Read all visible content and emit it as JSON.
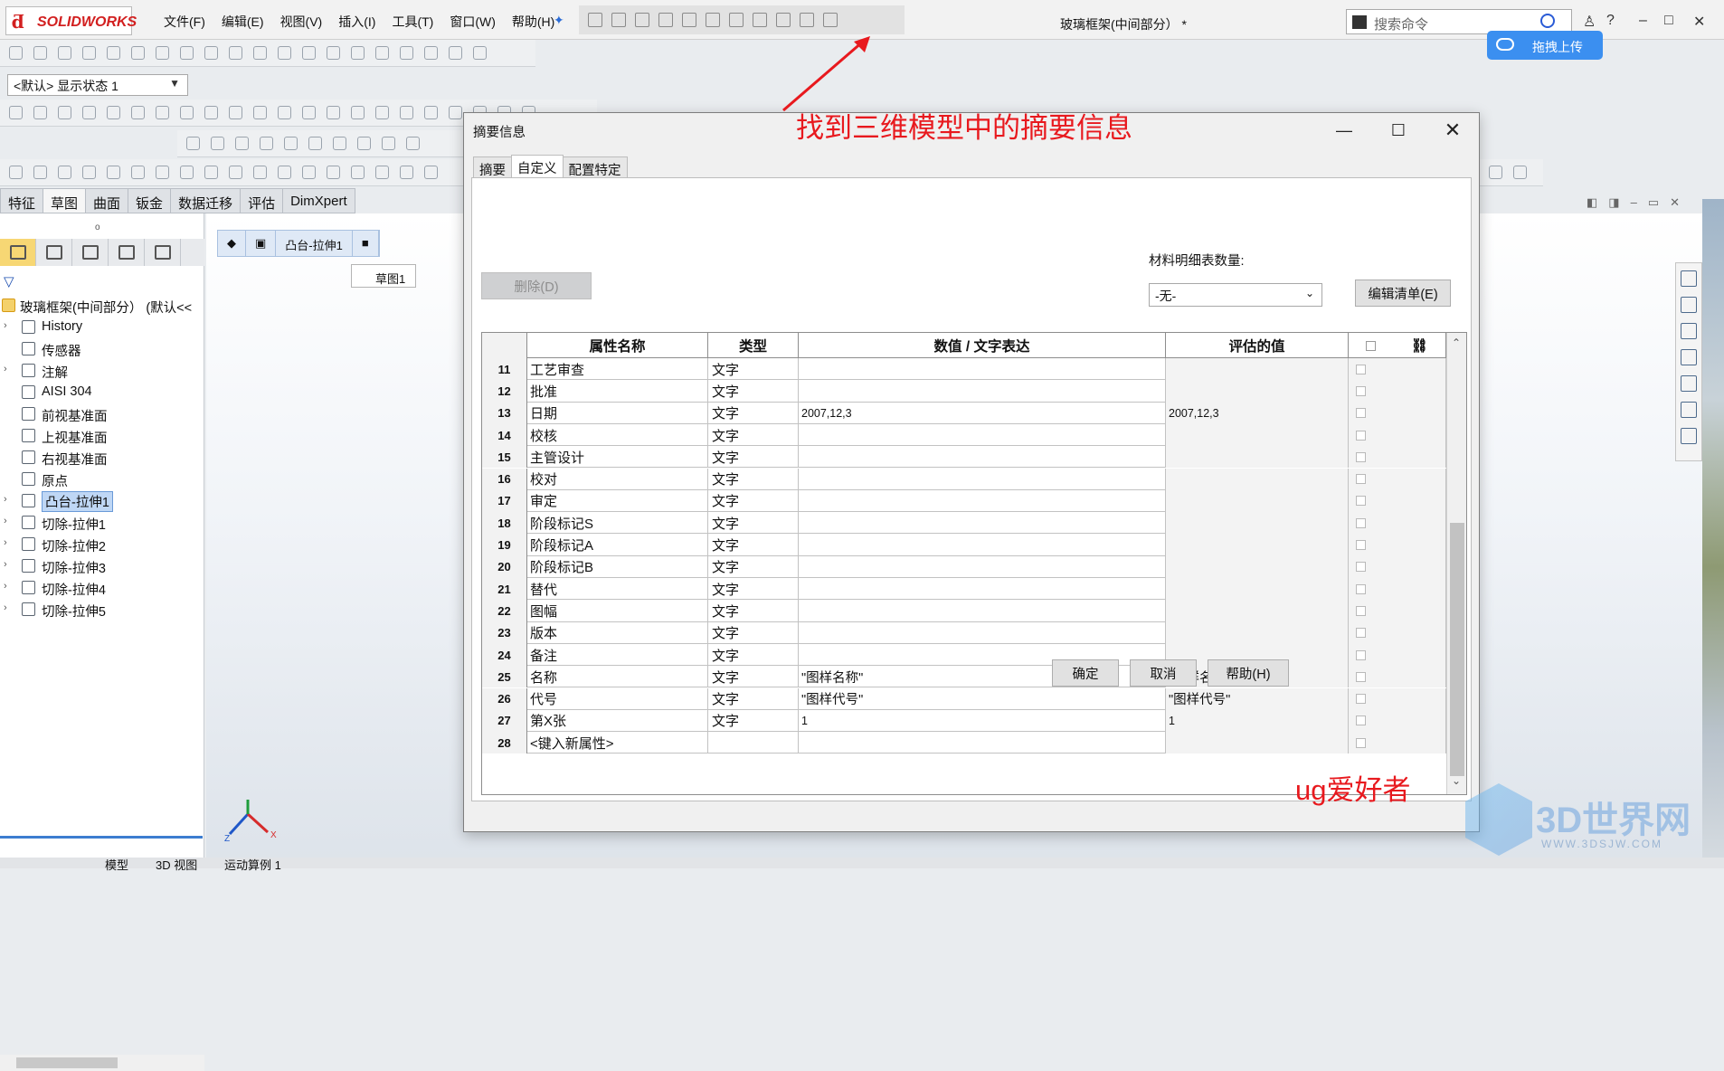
{
  "app": {
    "logo_text": "SOLIDWORKS",
    "menus": [
      "文件(F)",
      "编辑(E)",
      "视图(V)",
      "插入(I)",
      "工具(T)",
      "窗口(W)",
      "帮助(H)"
    ],
    "document_title": "玻璃框架(中间部分） *",
    "search_placeholder": "搜索命令",
    "upload_button": "拖拽上传",
    "display_state": "<默认> 显示状态 1"
  },
  "command_tabs": [
    "特征",
    "草图",
    "曲面",
    "钣金",
    "数据迁移",
    "评估",
    "DimXpert"
  ],
  "feature_tree": {
    "root": "玻璃框架(中间部分） (默认<<",
    "items": [
      {
        "label": "History",
        "expandable": true
      },
      {
        "label": "传感器",
        "expandable": false
      },
      {
        "label": "注解",
        "expandable": true
      },
      {
        "label": "AISI 304",
        "expandable": false
      },
      {
        "label": "前视基准面",
        "expandable": false
      },
      {
        "label": "上视基准面",
        "expandable": false
      },
      {
        "label": "右视基准面",
        "expandable": false
      },
      {
        "label": "原点",
        "expandable": false
      },
      {
        "label": "凸台-拉伸1",
        "expandable": true,
        "selected": true
      },
      {
        "label": "切除-拉伸1",
        "expandable": true
      },
      {
        "label": "切除-拉伸2",
        "expandable": true
      },
      {
        "label": "切除-拉伸3",
        "expandable": true
      },
      {
        "label": "切除-拉伸4",
        "expandable": true
      },
      {
        "label": "切除-拉伸5",
        "expandable": true
      }
    ]
  },
  "breadcrumb": {
    "feature": "凸台-拉伸1",
    "sketch": "草图1"
  },
  "bottom_tabs": [
    "模型",
    "3D 视图",
    "运动算例 1"
  ],
  "annotations": {
    "callout": "找到三维模型中的摘要信息",
    "signature": "ug爱好者",
    "watermark": "3D世界网",
    "watermark_url": "WWW.3DSJW.COM"
  },
  "dialog": {
    "title": "摘要信息",
    "tabs": [
      {
        "label": "摘要",
        "active": false
      },
      {
        "label": "自定义",
        "active": true
      },
      {
        "label": "配置特定",
        "active": false
      }
    ],
    "delete_button": "删除(D)",
    "bom_quantity_label": "材料明细表数量:",
    "bom_quantity_value": "-无-",
    "edit_list_button": "编辑清单(E)",
    "columns": [
      "属性名称",
      "类型",
      "数值 / 文字表达",
      "评估的值"
    ],
    "rows": [
      {
        "num": "11",
        "name": "工艺审查",
        "type": "文字",
        "value": "",
        "evaluated": ""
      },
      {
        "num": "12",
        "name": "批准",
        "type": "文字",
        "value": "",
        "evaluated": ""
      },
      {
        "num": "13",
        "name": "日期",
        "type": "文字",
        "value": "2007,12,3",
        "evaluated": "2007,12,3"
      },
      {
        "num": "14",
        "name": "校核",
        "type": "文字",
        "value": "",
        "evaluated": ""
      },
      {
        "num": "15",
        "name": "主管设计",
        "type": "文字",
        "value": "",
        "evaluated": ""
      },
      {
        "num": "16",
        "name": "校对",
        "type": "文字",
        "value": "",
        "evaluated": ""
      },
      {
        "num": "17",
        "name": "审定",
        "type": "文字",
        "value": "",
        "evaluated": ""
      },
      {
        "num": "18",
        "name": "阶段标记S",
        "type": "文字",
        "value": "",
        "evaluated": ""
      },
      {
        "num": "19",
        "name": "阶段标记A",
        "type": "文字",
        "value": "",
        "evaluated": ""
      },
      {
        "num": "20",
        "name": "阶段标记B",
        "type": "文字",
        "value": "",
        "evaluated": ""
      },
      {
        "num": "21",
        "name": "替代",
        "type": "文字",
        "value": "",
        "evaluated": ""
      },
      {
        "num": "22",
        "name": "图幅",
        "type": "文字",
        "value": "",
        "evaluated": ""
      },
      {
        "num": "23",
        "name": "版本",
        "type": "文字",
        "value": "",
        "evaluated": ""
      },
      {
        "num": "24",
        "name": "备注",
        "type": "文字",
        "value": "",
        "evaluated": ""
      },
      {
        "num": "25",
        "name": "名称",
        "type": "文字",
        "value": "\"图样名称\"",
        "evaluated": "\"图样名称\""
      },
      {
        "num": "26",
        "name": "代号",
        "type": "文字",
        "value": "\"图样代号\"",
        "evaluated": "\"图样代号\""
      },
      {
        "num": "27",
        "name": "第X张",
        "type": "文字",
        "value": "1",
        "evaluated": "1"
      },
      {
        "num": "28",
        "name": "<键入新属性>",
        "type": "",
        "value": "",
        "evaluated": ""
      }
    ],
    "ok_button": "确定",
    "cancel_button": "取消",
    "help_button": "帮助(H)"
  }
}
